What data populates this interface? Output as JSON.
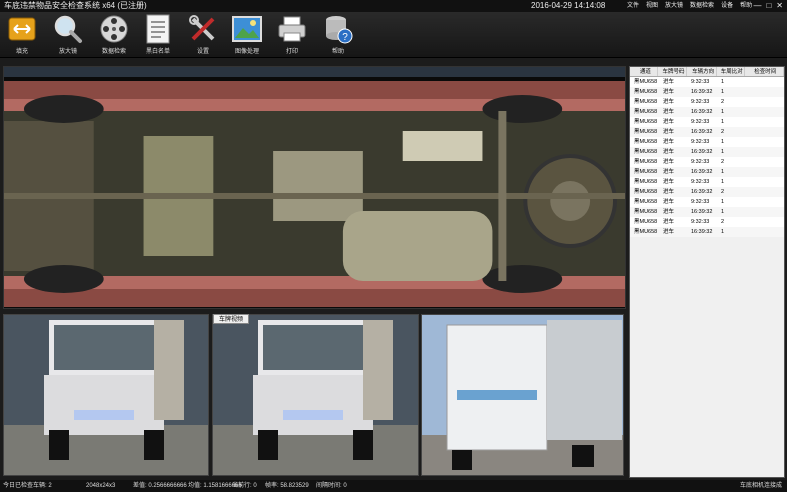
{
  "window": {
    "title": "车底违禁物品安全检查系统 x64 (已注册)",
    "clock": "2016-04-29 14:14:08",
    "menus": [
      "文件",
      "视图",
      "放大镜",
      "数据检索",
      "设备",
      "帮助"
    ],
    "controls": [
      "—",
      "□",
      "✕"
    ]
  },
  "toolbar": {
    "items": [
      {
        "label": "填充",
        "icon": "fill-icon"
      },
      {
        "label": "放大镜",
        "icon": "magnifier-icon"
      },
      {
        "label": "数据检索",
        "icon": "film-reel-icon"
      },
      {
        "label": "黑白名单",
        "icon": "list-document-icon"
      },
      {
        "label": "设置",
        "icon": "tools-icon"
      },
      {
        "label": "图像处理",
        "icon": "image-icon"
      },
      {
        "label": "打印",
        "icon": "printer-icon"
      },
      {
        "label": "帮助",
        "icon": "database-help-icon"
      }
    ]
  },
  "table": {
    "headers": [
      "通道",
      "车牌号码",
      "车辆方向",
      "车周比对",
      "检查时间"
    ],
    "rows": [
      [
        "黑MU658",
        "进车",
        "9:32:33",
        "1"
      ],
      [
        "黑MU658",
        "进车",
        "16:39:32",
        "1"
      ],
      [
        "黑MU658",
        "进车",
        "9:32:33",
        "2"
      ],
      [
        "黑MU658",
        "进车",
        "16:39:32",
        "1"
      ],
      [
        "黑MU658",
        "进车",
        "9:32:33",
        "1"
      ],
      [
        "黑MU658",
        "进车",
        "16:39:32",
        "2"
      ],
      [
        "黑MU658",
        "进车",
        "9:32:33",
        "1"
      ],
      [
        "黑MU658",
        "进车",
        "16:39:32",
        "1"
      ],
      [
        "黑MU658",
        "进车",
        "9:32:33",
        "2"
      ],
      [
        "黑MU658",
        "进车",
        "16:39:32",
        "1"
      ],
      [
        "黑MU658",
        "进车",
        "9:32:33",
        "1"
      ],
      [
        "黑MU658",
        "进车",
        "16:39:32",
        "2"
      ],
      [
        "黑MU658",
        "进车",
        "9:32:33",
        "1"
      ],
      [
        "黑MU658",
        "进车",
        "16:39:32",
        "1"
      ],
      [
        "黑MU658",
        "进车",
        "9:32:33",
        "2"
      ],
      [
        "黑MU658",
        "进车",
        "16:39:32",
        "1"
      ]
    ]
  },
  "cameras": {
    "tab_label": "车牌视频"
  },
  "status": {
    "count": "今日已检查车辆: 2",
    "resolution": "2048x24x3",
    "diff": "差值: 0.2566666666",
    "avg": "均值: 1.1581666666",
    "current_row": "当前行: 0",
    "fps": "帧率: 58.823529",
    "interval": "间隔时间: 0",
    "camera_status": "车底相机连接成功"
  },
  "colors": {
    "toolbar_bg": "#1c1c1c",
    "table_bg": "#f0f0f0",
    "scan_stripe": "#b36a62"
  }
}
